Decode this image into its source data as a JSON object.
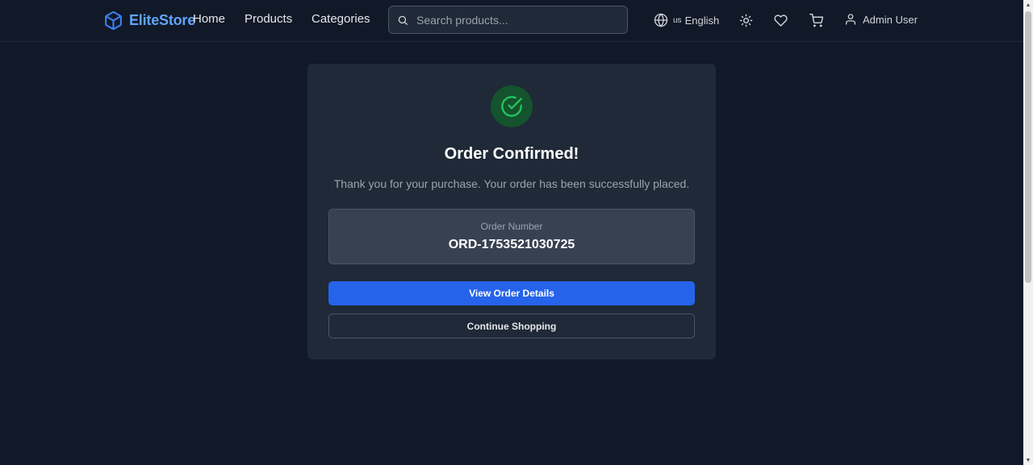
{
  "header": {
    "brand": "EliteStore",
    "nav": {
      "home": "Home",
      "products": "Products",
      "categories": "Categories"
    },
    "search": {
      "placeholder": "Search products..."
    },
    "language": {
      "flag": "us",
      "label": "English"
    },
    "user": {
      "name": "Admin User"
    }
  },
  "confirmation": {
    "title": "Order Confirmed!",
    "message": "Thank you for your purchase. Your order has been successfully placed.",
    "order_number_label": "Order Number",
    "order_number": "ORD-1753521030725",
    "view_details_label": "View Order Details",
    "continue_label": "Continue Shopping"
  },
  "icons": {
    "logo": "box-icon",
    "search": "search-icon",
    "language": "globe-icon",
    "theme": "sun-icon",
    "wishlist": "heart-icon",
    "cart": "cart-icon",
    "user": "user-icon",
    "success": "check-circle-icon"
  },
  "colors": {
    "background": "#111827",
    "card": "#1f2937",
    "accent": "#2563eb",
    "brand": "#60a5fa",
    "success": "#22c55e"
  }
}
